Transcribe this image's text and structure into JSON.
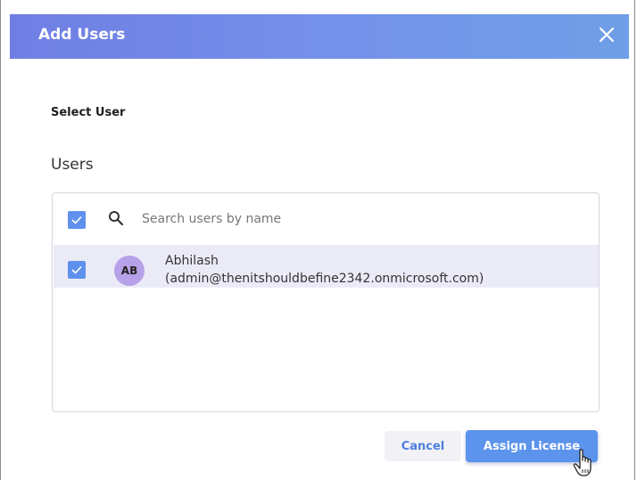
{
  "dialog": {
    "title": "Add Users"
  },
  "select_user_label": "Select User",
  "users_section_label": "Users",
  "search": {
    "value": "",
    "placeholder": "Search users by name",
    "select_all_checked": true
  },
  "users": [
    {
      "initials": "AB",
      "name": "Abhilash",
      "email": "(admin@thenitshouldbefine2342.onmicrosoft.com)",
      "checked": true
    }
  ],
  "actions": {
    "cancel_label": "Cancel",
    "assign_label": "Assign License"
  },
  "colors": {
    "header_gradient_start": "#6f7ee3",
    "header_gradient_end": "#6f9fe6",
    "accent": "#5c93ec",
    "selected_row": "#ebebf8",
    "avatar": "#b7a1e8"
  },
  "icons": {
    "close": "close-icon",
    "search": "search-icon",
    "check": "check-icon",
    "cursor": "hand-pointer-cursor-icon"
  }
}
